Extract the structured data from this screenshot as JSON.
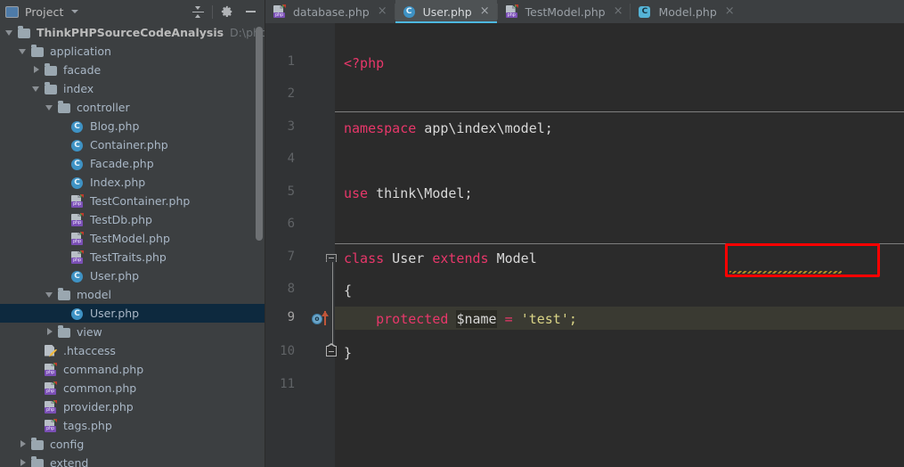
{
  "project_panel": {
    "title": "Project",
    "toolbar_icons": [
      "collapse-all-icon",
      "settings-gear-icon",
      "minimize-icon"
    ],
    "tree": [
      {
        "indent": 0,
        "twisty": "open",
        "icon": "folder-icon",
        "label": "ThinkPHPSourceCodeAnalysis",
        "bold": true,
        "sub": "D:\\phpstudy_"
      },
      {
        "indent": 1,
        "twisty": "open",
        "icon": "folder-icon",
        "label": "application"
      },
      {
        "indent": 2,
        "twisty": "closed",
        "icon": "folder-icon",
        "label": "facade"
      },
      {
        "indent": 2,
        "twisty": "open",
        "icon": "folder-icon",
        "label": "index"
      },
      {
        "indent": 3,
        "twisty": "open",
        "icon": "folder-icon",
        "label": "controller"
      },
      {
        "indent": 4,
        "twisty": "none",
        "icon": "php-class-icon",
        "label": "Blog.php"
      },
      {
        "indent": 4,
        "twisty": "none",
        "icon": "php-class-icon",
        "label": "Container.php"
      },
      {
        "indent": 4,
        "twisty": "none",
        "icon": "php-class-icon",
        "label": "Facade.php"
      },
      {
        "indent": 4,
        "twisty": "none",
        "icon": "php-class-icon",
        "label": "Index.php"
      },
      {
        "indent": 4,
        "twisty": "none",
        "icon": "php-file-icon",
        "label": "TestContainer.php"
      },
      {
        "indent": 4,
        "twisty": "none",
        "icon": "php-file-icon",
        "label": "TestDb.php"
      },
      {
        "indent": 4,
        "twisty": "none",
        "icon": "php-file-icon",
        "label": "TestModel.php"
      },
      {
        "indent": 4,
        "twisty": "none",
        "icon": "php-file-icon",
        "label": "TestTraits.php"
      },
      {
        "indent": 4,
        "twisty": "none",
        "icon": "php-class-icon",
        "label": "User.php"
      },
      {
        "indent": 3,
        "twisty": "open",
        "icon": "folder-icon",
        "label": "model"
      },
      {
        "indent": 4,
        "twisty": "none",
        "icon": "php-class-icon",
        "label": "User.php",
        "selected": true
      },
      {
        "indent": 3,
        "twisty": "closed",
        "icon": "folder-icon",
        "label": "view"
      },
      {
        "indent": 2,
        "twisty": "none",
        "icon": "htaccess-icon",
        "label": ".htaccess"
      },
      {
        "indent": 2,
        "twisty": "none",
        "icon": "php-file-icon",
        "label": "command.php"
      },
      {
        "indent": 2,
        "twisty": "none",
        "icon": "php-file-icon",
        "label": "common.php"
      },
      {
        "indent": 2,
        "twisty": "none",
        "icon": "php-file-icon",
        "label": "provider.php"
      },
      {
        "indent": 2,
        "twisty": "none",
        "icon": "php-file-icon",
        "label": "tags.php"
      },
      {
        "indent": 1,
        "twisty": "closed",
        "icon": "folder-icon",
        "label": "config"
      },
      {
        "indent": 1,
        "twisty": "closed",
        "icon": "folder-icon",
        "label": "extend"
      }
    ]
  },
  "editor": {
    "tabs": [
      {
        "label": "database.php",
        "icon": "php-file-icon",
        "active": false,
        "close": "×"
      },
      {
        "label": "User.php",
        "icon": "php-class-icon",
        "active": true,
        "close": "×"
      },
      {
        "label": "TestModel.php",
        "icon": "php-file-icon",
        "active": false,
        "close": "×"
      },
      {
        "label": "Model.php",
        "icon": "php-abstract-class-icon",
        "active": false,
        "close": "×"
      }
    ],
    "line_numbers": [
      "1",
      "2",
      "3",
      "4",
      "5",
      "6",
      "7",
      "8",
      "9",
      "10",
      "11"
    ],
    "current_line": "9",
    "gutter_markers": [
      {
        "line": "7",
        "type": "fold-collapse-icon"
      },
      {
        "line": "9",
        "type": "overriding-method-icon"
      },
      {
        "line": "10",
        "type": "fold-end-icon"
      }
    ],
    "code": {
      "l1_open_tag": "<?php",
      "l3_kw": "namespace",
      "l3_rest": " app\\index\\model;",
      "l5_kw": "use",
      "l5_rest": " think\\Model;",
      "l7_kw1": "class",
      "l7_name": " User ",
      "l7_kw2": "extends",
      "l7_parent": " Model",
      "l8": "{",
      "l9_kw": "protected",
      "l9_var": "$name",
      "l9_eq": "=",
      "l9_str": "'test';",
      "l10": "}"
    },
    "annotation": {
      "shape": "rectangle",
      "color": "#ff0000",
      "target": "extends Model"
    }
  },
  "colors": {
    "keyword": "#e8376a",
    "string": "#d9d486",
    "plain": "#d8d8d8",
    "editor_bg": "#2b2b2b",
    "panel_bg": "#3c3f41",
    "selection": "#0d293e",
    "tab_active_underline": "#4eb8e0",
    "annotation": "#ff0000"
  }
}
